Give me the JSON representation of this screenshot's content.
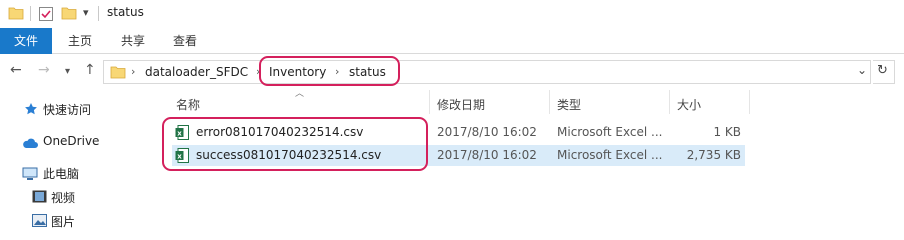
{
  "window": {
    "title": "status"
  },
  "ribbon": {
    "tabs": [
      {
        "label": "文件",
        "active": true
      },
      {
        "label": "主页"
      },
      {
        "label": "共享"
      },
      {
        "label": "查看"
      }
    ]
  },
  "address": {
    "crumbs": [
      "dataloader_SFDC",
      "Inventory",
      "status"
    ]
  },
  "navigation": {
    "items": [
      {
        "label": "快速访问",
        "icon": "star-icon"
      },
      {
        "label": "OneDrive",
        "icon": "cloud-icon"
      },
      {
        "label": "此电脑",
        "icon": "computer-icon"
      },
      {
        "label": "视频",
        "icon": "video-icon"
      },
      {
        "label": "图片",
        "icon": "pictures-icon"
      }
    ]
  },
  "columns": [
    "名称",
    "修改日期",
    "类型",
    "大小"
  ],
  "files": [
    {
      "name": "error081017040232514.csv",
      "date": "2017/8/10 16:02",
      "type": "Microsoft Excel ...",
      "size": "1 KB",
      "icon": "excel-csv-icon"
    },
    {
      "name": "success081017040232514.csv",
      "date": "2017/8/10 16:02",
      "type": "Microsoft Excel ...",
      "size": "2,735 KB",
      "icon": "excel-csv-icon",
      "selected": true
    }
  ],
  "colors": {
    "accent": "#1979ca",
    "annotation": "#d4205c",
    "selection": "#d9ebf9"
  }
}
